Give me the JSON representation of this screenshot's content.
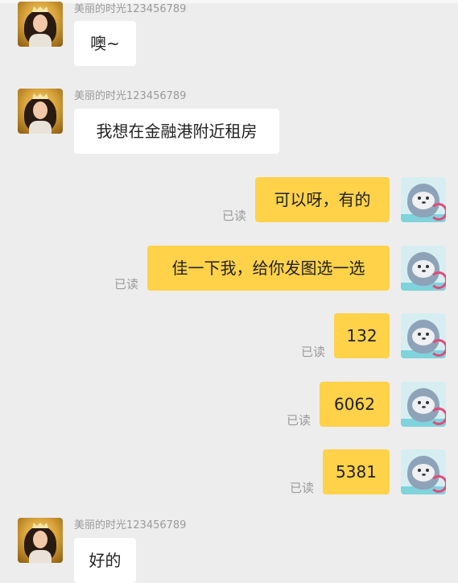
{
  "colors": {
    "background": "#ededed",
    "incoming_bubble": "#ffffff",
    "outgoing_bubble": "#ffd24a",
    "meta_text": "#9a9a9a"
  },
  "messages": [
    {
      "direction": "incoming",
      "sender": "美丽的时光123456789",
      "text": "噢~"
    },
    {
      "direction": "incoming",
      "sender": "美丽的时光123456789",
      "text": "我想在金融港附近租房"
    },
    {
      "direction": "outgoing",
      "text": "可以呀，有的",
      "status": "已读"
    },
    {
      "direction": "outgoing",
      "text": "佳一下我，给你发图选一选",
      "status": "已读"
    },
    {
      "direction": "outgoing",
      "text": "132",
      "status": "已读"
    },
    {
      "direction": "outgoing",
      "text": "6062",
      "status": "已读"
    },
    {
      "direction": "outgoing",
      "text": "5381",
      "status": "已读"
    },
    {
      "direction": "incoming",
      "sender": "美丽的时光123456789",
      "text": "好的"
    }
  ],
  "avatars": {
    "contact": "woman-with-crown-avatar",
    "self": "seal-cartoon-avatar"
  }
}
